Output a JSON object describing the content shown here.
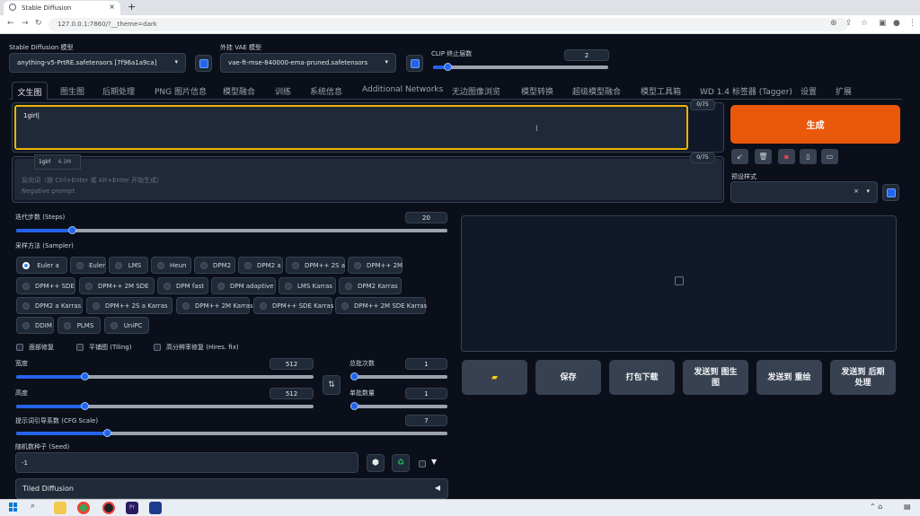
{
  "browser": {
    "tab_title": "Stable Diffusion",
    "url": "127.0.0.1:7860/?__theme=dark"
  },
  "top": {
    "model_label": "Stable Diffusion 模型",
    "model_value": "anything-v5-PrtRE.safetensors [7f96a1a9ca]",
    "vae_label": "外挂 VAE 模型",
    "vae_value": "vae-ft-mse-840000-ema-pruned.safetensors",
    "clip_label": "CLIP 终止层数",
    "clip_value": "2",
    "clip_fraction": 0.083
  },
  "tabs": [
    "文生图",
    "图生图",
    "后期处理",
    "PNG 图片信息",
    "模型融合",
    "训练",
    "系统信息",
    "Additional Networks",
    "无边图像浏览",
    "模型转换",
    "超级模型融合",
    "模型工具箱",
    "WD 1.4 标签器 (Tagger)",
    "设置",
    "扩展"
  ],
  "prompt": {
    "text": "1girl",
    "counter": "0/75",
    "autocomplete_word": "1girl",
    "autocomplete_count": "4.1M"
  },
  "negative": {
    "placeholder": "反向词（按 Ctrl+Enter 或 Alt+Enter 开始生成）\nNegative prompt",
    "counter": "0/75"
  },
  "generate_label": "生成",
  "styles_label": "预设样式",
  "steps": {
    "label": "迭代步数 (Steps)",
    "value": "20",
    "fraction": 0.13
  },
  "sampler": {
    "label": "采样方法 (Sampler)",
    "options": [
      "Euler a",
      "Euler",
      "LMS",
      "Heun",
      "DPM2",
      "DPM2 a",
      "DPM++ 2S a",
      "DPM++ 2M",
      "DPM++ SDE",
      "DPM++ 2M SDE",
      "DPM fast",
      "DPM adaptive",
      "LMS Karras",
      "DPM2 Karras",
      "DPM2 a Karras",
      "DPM++ 2S a Karras",
      "DPM++ 2M Karras",
      "DPM++ SDE Karras",
      "DPM++ 2M SDE Karras",
      "DDIM",
      "PLMS",
      "UniPC"
    ],
    "selected": "Euler a"
  },
  "checks": [
    "面部修复",
    "平铺图 (Tiling)",
    "高分辨率修复 (Hires. fix)"
  ],
  "width": {
    "label": "宽度",
    "value": "512",
    "fraction": 0.23
  },
  "height": {
    "label": "高度",
    "value": "512",
    "fraction": 0.23
  },
  "batch_count": {
    "label": "总批次数",
    "value": "1",
    "fraction": 0.0
  },
  "batch_size": {
    "label": "单批数量",
    "value": "1",
    "fraction": 0.0
  },
  "cfg": {
    "label": "提示词引导系数 (CFG Scale)",
    "value": "7",
    "fraction": 0.21
  },
  "seed": {
    "label": "随机数种子 (Seed)",
    "value": "-1"
  },
  "tiled_diffusion": "Tiled Diffusion",
  "actions": {
    "folder_icon": "folder-icon",
    "save": "保存",
    "zip": "打包下载",
    "send_img2img": "发送到 图生图",
    "send_inpaint": "发送到 重绘",
    "send_extras": "发送到 后期处理"
  },
  "colors": {
    "accent": "#ea580c",
    "selection": "#2563eb",
    "focus": "#eab308"
  }
}
